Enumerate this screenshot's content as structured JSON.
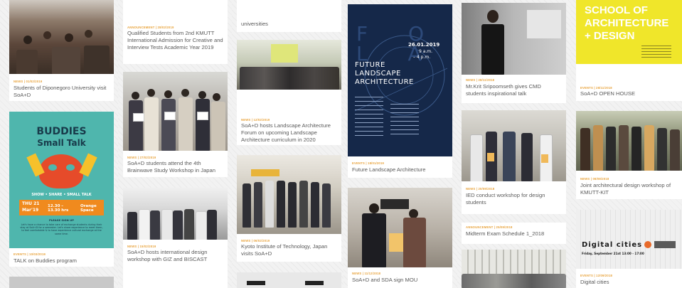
{
  "cards": [
    {
      "id": "c1",
      "category": "NEWS | 01/02/2019",
      "title": "Students of Diponegoro University visit SoA+D"
    },
    {
      "id": "c2",
      "category": "EVENTS | 10/03/2019",
      "title": "TALK on Buddies program",
      "poster": {
        "line1": "BUDDIES",
        "line2": "Small Talk",
        "tagline": "SHOW • SHARE • SMALL TALK",
        "day": "THU 21",
        "month": "Mar'19",
        "time": "12.30 – 13.30 hrs",
        "place": "Orange Space",
        "please": "PLEASE SIGN UP",
        "note": "Let's have a chance to take care of exchange students during their stay at SoA+D for a semester. Let's share experience to meet them, to feel comfortable & to have experience cultural exchange at the same time."
      }
    },
    {
      "id": "c3",
      "category": "ANNOUNCEMENT | 28/02/2019",
      "title": "Qualified Students from 2nd KMUTT International Admission for Creative and Interview Tests Academic Year 2019"
    },
    {
      "id": "c4",
      "category": "NEWS | 27/02/2019",
      "title": "SoA+D students attend the 4th Brainwave Study Workshop in Japan"
    },
    {
      "id": "c5",
      "category": "NEWS | 15/02/2019",
      "title": "SoA+D hosts international design workshop with GIZ and BISCAST"
    },
    {
      "id": "c6",
      "category": "",
      "title": "universities"
    },
    {
      "id": "c7",
      "category": "NEWS | 12/02/2019",
      "title": "SoA+D hosts Landscape Architecture Forum on upcoming Landscape Architecture curriculum in 2020"
    },
    {
      "id": "c8",
      "category": "NEWS | 06/02/2019",
      "title": "Kyoto Institute of Technology, Japan visits SoA+D"
    },
    {
      "id": "c9",
      "category": "EVENTS | 18/01/2019",
      "title": "Future Landscape Architecture",
      "poster": {
        "date": "26.01.2019",
        "time1": "9 a.m.",
        "time2": "– 4 p.m.",
        "title": "FUTURE LANDSCAPE ARCHITECTURE",
        "big": "F O L A"
      }
    },
    {
      "id": "c10",
      "category": "NEWS | 11/12/2018",
      "title": "SoA+D and SDA sign MOU"
    },
    {
      "id": "c11",
      "category": "NEWS | 28/11/2018",
      "title": "Mr.Krit Sripoomseth gives CMD students inspirational talk"
    },
    {
      "id": "c12",
      "category": "NEWS | 20/09/2018",
      "title": "IED conduct workshop for design students"
    },
    {
      "id": "c13",
      "category": "ANNOUNCEMENT | 25/09/2018",
      "title": "Midterm Exam Schedule 1_2018"
    },
    {
      "id": "c14",
      "category": "EVENTS | 28/11/2018",
      "title": "SoA+D OPEN HOUSE",
      "poster": {
        "l1": "SCHOOL OF",
        "l2": "ARCHITECTURE",
        "l3": "+ DESIGN"
      }
    },
    {
      "id": "c15",
      "category": "NEWS | 08/08/2018",
      "title": "Joint architectural design workshop of KMUTT-KIT"
    },
    {
      "id": "c16",
      "category": "EVENTS | 12/09/2018",
      "title": "Digital cities",
      "poster": {
        "title": "Digital cities",
        "info": "Friday, September 21st 13:00 - 17:00"
      }
    }
  ],
  "colors": {
    "category": "#e8a33c",
    "title": "#5a5a5a",
    "hatch": "#f2f2f2",
    "navy": "#152849",
    "yellow": "#f0e62a",
    "orange": "#f08a1e"
  }
}
